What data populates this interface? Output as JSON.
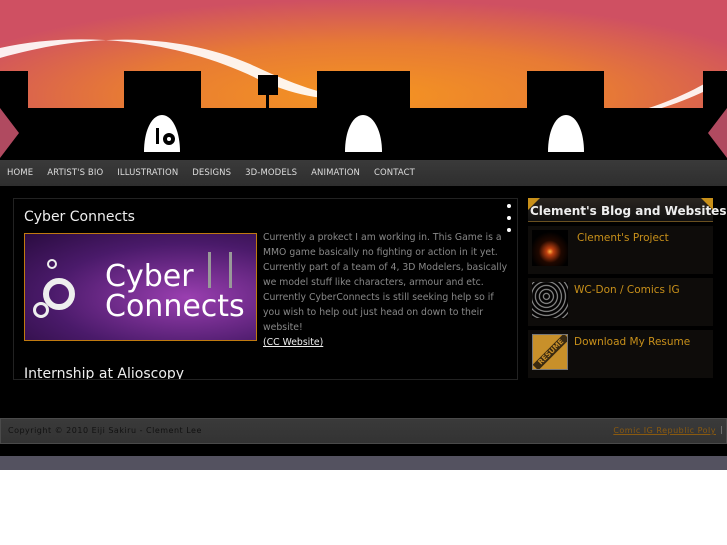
{
  "nav": {
    "items": [
      "HOME",
      "ARTIST'S BIO",
      "ILLUSTRATION",
      "DESIGNS",
      "3D-MODELS",
      "ANIMATION",
      "CONTACT"
    ]
  },
  "posts": [
    {
      "title": "Cyber Connects",
      "image_text": [
        "Cyber",
        "Connects"
      ],
      "body": "Currently a prokect I am working in. This Game is a MMO game basically no fighting or action in it yet. Currently part of a team of 4, 3D Modelers, basically we model stuff like characters, armour and etc. Currently CyberConnects is still seeking help so if you wish to help out just head on down to their website!",
      "link": "(CC Website)"
    },
    {
      "title": "Internship at Alioscopy"
    }
  ],
  "sidebar": {
    "title": "Clement's Blog and Websites",
    "items": [
      {
        "label": "Clement's Project"
      },
      {
        "label": "WC-Don / Comics IG"
      },
      {
        "label": "Download My Resume",
        "thumb_text": "RESUME"
      }
    ]
  },
  "footer": {
    "copyright": "Copyright © 2010 Eiji Sakiru - Clement Lee",
    "link": "Comic IG Republic Poly",
    "separator": "|"
  },
  "colors": {
    "accent": "#c8901a",
    "sky_center": "#f39020",
    "sky_edge": "#d85a6a"
  }
}
